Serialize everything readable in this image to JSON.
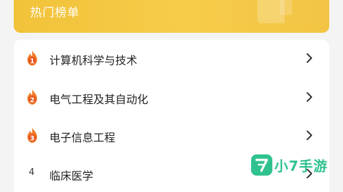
{
  "header": {
    "title": "热门榜单"
  },
  "ranking": [
    {
      "rank": "1",
      "label": "计算机科学与技术",
      "icon": "flame-rank-1-icon"
    },
    {
      "rank": "2",
      "label": "电气工程及其自动化",
      "icon": "flame-rank-2-icon"
    },
    {
      "rank": "3",
      "label": "电子信息工程",
      "icon": "flame-rank-3-icon"
    },
    {
      "rank": "4",
      "label": "临床医学",
      "icon": null
    }
  ],
  "watermark": {
    "text": "小7手游"
  },
  "colors": {
    "header_gradient": "#f4c541",
    "flame_outer": "#f07a28",
    "flame_inner": "#ffffff",
    "chevron": "#333333",
    "watermark": "#2fc28e"
  }
}
